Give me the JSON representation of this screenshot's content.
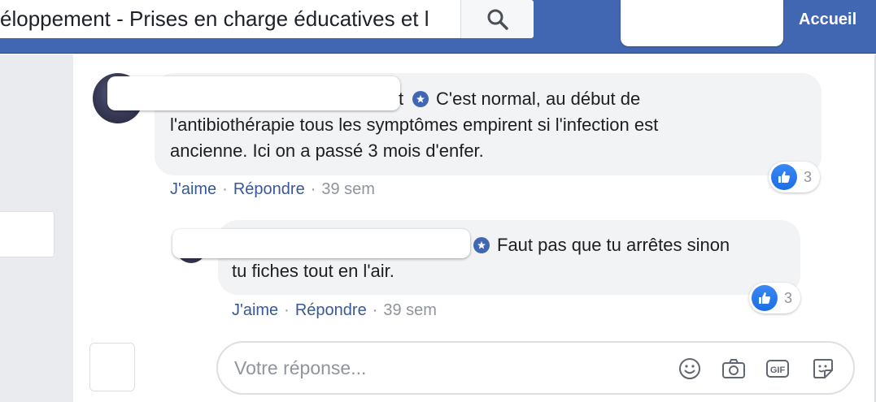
{
  "header": {
    "search_value": "éloppement - Prises en charge éducatives et l",
    "home_label": "Accueil"
  },
  "comments": [
    {
      "author_suffix": "t",
      "text_lines": [
        "C'est normal, au début de",
        "l'antibiothérapie tous les symptômes empirent si l'infection est",
        "ancienne. Ici on a passé 3 mois d'enfer."
      ],
      "like_label": "J'aime",
      "reply_label": "Répondre",
      "time": "39 sem",
      "reaction_count": "3"
    },
    {
      "author_suffix": "",
      "text_lines": [
        "Faut pas que tu arrêtes sinon",
        "tu fiches tout en l'air."
      ],
      "like_label": "J'aime",
      "reply_label": "Répondre",
      "time": "39 sem",
      "reaction_count": "3"
    }
  ],
  "reply": {
    "placeholder": "Votre réponse...",
    "tools": [
      "emoji-icon",
      "camera-icon",
      "gif-icon",
      "sticker-icon"
    ]
  },
  "colors": {
    "header_blue": "#4267b2",
    "link_blue": "#385898",
    "like_blue": "#1a6ee6",
    "bubble_gray": "#f2f3f5"
  }
}
